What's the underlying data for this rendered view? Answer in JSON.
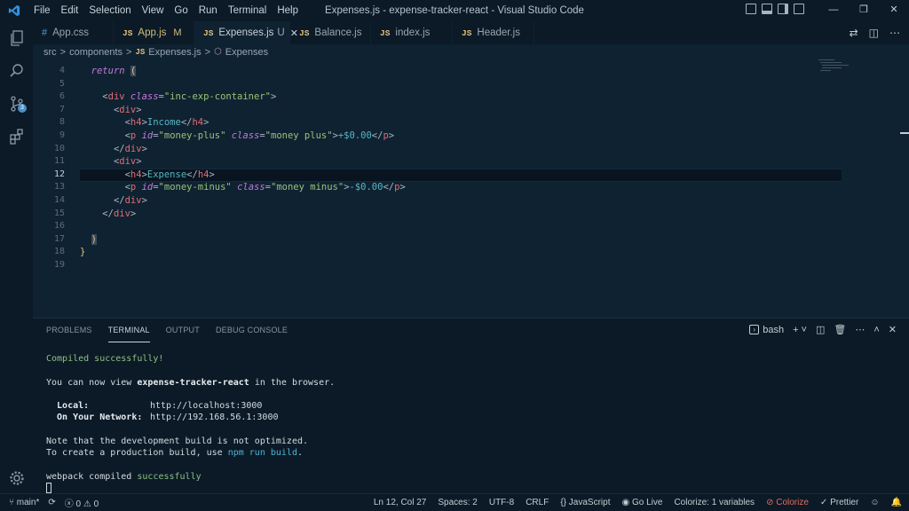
{
  "window": {
    "title": "Expenses.js - expense-tracker-react - Visual Studio Code",
    "menu": [
      "File",
      "Edit",
      "Selection",
      "View",
      "Go",
      "Run",
      "Terminal",
      "Help"
    ],
    "controls": [
      "—",
      "❐",
      "✕"
    ]
  },
  "activity": {
    "items": [
      "explorer-icon",
      "search-icon",
      "source-control-icon",
      "extensions-icon"
    ],
    "scm_badge": "3",
    "settings": "settings-gear-icon"
  },
  "tabs": [
    {
      "kind": "css",
      "icon": "#",
      "label": "App.css",
      "extra": "",
      "modified": false
    },
    {
      "kind": "js",
      "icon": "JS",
      "label": "App.js",
      "extra": "M",
      "modified": true
    },
    {
      "kind": "js",
      "icon": "JS",
      "label": "Expenses.js",
      "extra": "U",
      "close": "✕",
      "active": true
    },
    {
      "kind": "js",
      "icon": "JS",
      "label": "Balance.js",
      "extra": ""
    },
    {
      "kind": "js",
      "icon": "JS",
      "label": "index.js",
      "extra": ""
    },
    {
      "kind": "js",
      "icon": "JS",
      "label": "Header.js",
      "extra": ""
    }
  ],
  "breadcrumb": {
    "parts": [
      "src",
      ">",
      "components",
      ">"
    ],
    "file_icon": "JS",
    "file": "Expenses.js",
    "sep": ">",
    "symbol_icon": "⬡",
    "symbol": "Expenses"
  },
  "editor": {
    "current_line": "12",
    "line_numbers": [
      "4",
      "5",
      "6",
      "7",
      "8",
      "9",
      "10",
      "11",
      "12",
      "13",
      "14",
      "15",
      "16",
      "17",
      "18",
      "19"
    ]
  },
  "panel": {
    "tabs": [
      "PROBLEMS",
      "TERMINAL",
      "OUTPUT",
      "DEBUG CONSOLE"
    ],
    "active_tab": "TERMINAL",
    "shell": "bash",
    "terminal": {
      "compiled": "Compiled successfully!",
      "view_pre": "You can now view ",
      "project": "expense-tracker-react",
      "view_post": " in the browser.",
      "local_label": "  Local:",
      "local_url": "http://localhost:3000",
      "network_label": "  On Your Network:",
      "network_url": "http://192.168.56.1:3000",
      "note1": "Note that the development build is not optimized.",
      "note2_pre": "To create a production build, use ",
      "note2_cmd": "npm run build",
      "note2_post": ".",
      "webpack_pre": "webpack compiled ",
      "webpack_status": "successfully"
    }
  },
  "status": {
    "branch": "main*",
    "errors": "0",
    "warnings": "0",
    "position": "Ln 12, Col 27",
    "spaces": "Spaces: 2",
    "encoding": "UTF-8",
    "eol": "CRLF",
    "language": "JavaScript",
    "golive": "Go Live",
    "colorize_vars": "Colorize: 1 variables",
    "colorize": "Colorize",
    "prettier": "Prettier"
  }
}
